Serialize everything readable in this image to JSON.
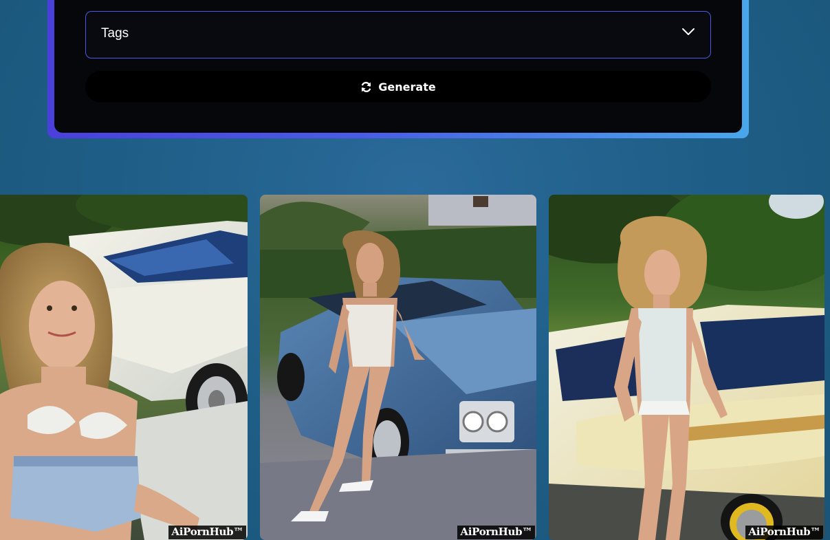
{
  "tags_select": {
    "label": "Tags",
    "icon": "chevron-down-icon"
  },
  "generate_button": {
    "label": "Generate",
    "icon": "refresh-icon"
  },
  "gallery": {
    "images": [
      {
        "watermark": "AiPornHub™"
      },
      {
        "watermark": "AiPornHub™"
      },
      {
        "watermark": "AiPornHub™"
      }
    ]
  },
  "colors": {
    "page_background": "#1f5f88",
    "panel_background": "#05070b",
    "panel_border_start": "#4b3fdc",
    "panel_border_end": "#4aa7ea",
    "select_border": "#4b59e8"
  }
}
